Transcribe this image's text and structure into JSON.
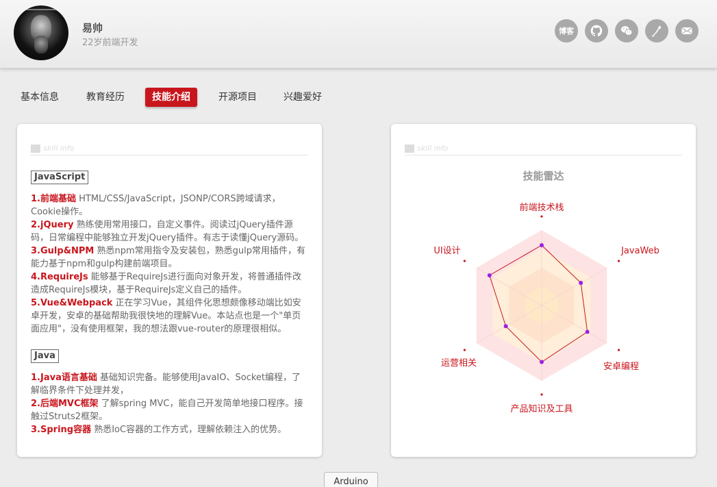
{
  "profile": {
    "name": "易帅",
    "subtitle": "22岁前端开发"
  },
  "social": [
    {
      "icon": "blog-icon",
      "label": "博客"
    },
    {
      "icon": "github-icon"
    },
    {
      "icon": "wechat-icon"
    },
    {
      "icon": "phone-icon"
    },
    {
      "icon": "mail-icon"
    }
  ],
  "tabs": [
    {
      "label": "基本信息"
    },
    {
      "label": "教育经历"
    },
    {
      "label": "技能介绍",
      "active": true
    },
    {
      "label": "开源项目"
    },
    {
      "label": "兴趣爱好"
    }
  ],
  "skill_card": {
    "header": "skill info",
    "sections": [
      {
        "title": "JavaScript",
        "items": [
          {
            "key": "1.前端基础",
            "text": " HTML/CSS/JavaScript，JSONP/CORS跨域请求，Cookie操作。"
          },
          {
            "key": "2.jQuery",
            "text": " 熟练使用常用接口，自定义事件。阅读过jQuery插件源码，日常编程中能够独立开发jQuery插件。有志于读懂jQuery源码。"
          },
          {
            "key": "3.Gulp&NPM",
            "text": " 熟悉npm常用指令及安装包，熟悉gulp常用插件，有能力基于npm和gulp构建前端项目。"
          },
          {
            "key": "4.RequireJs",
            "text": " 能够基于RequireJs进行面向对象开发，将普通插件改造成RequireJs模块，基于RequireJs定义自己的插件。"
          },
          {
            "key": "5.Vue&Webpack",
            "text": " 正在学习Vue，其组件化思想颇像移动端比如安卓开发，安卓的基础帮助我很快地的理解Vue。本站点也是一个\"单页面应用\"，没有使用框架，我的想法跟vue-router的原理很相似。"
          }
        ]
      },
      {
        "title": "Java",
        "items": [
          {
            "key": "1.Java语言基础",
            "text": " 基础知识完备。能够使用JavaIO、Socket编程，了解临界条件下处理并发，"
          },
          {
            "key": "2.后端MVC框架",
            "text": " 了解spring MVC，能自己开发简单地接口程序。接触过Struts2框架。"
          },
          {
            "key": "3.Spring容器",
            "text": " 熟悉IoC容器的工作方式，理解依赖注入的优势。"
          }
        ]
      }
    ]
  },
  "radar_card": {
    "header": "skill info",
    "title": "技能雷达",
    "indicators": [
      "前端技术栈",
      "JavaWeb",
      "安卓编程",
      "产品知识及工具",
      "运营相关",
      "UI设计"
    ],
    "values": [
      0.8,
      0.6,
      0.7,
      0.75,
      0.55,
      0.8
    ],
    "colors": {
      "line": "#c8161d",
      "point": "#9b1ee8",
      "band_outer": "#fde3e4",
      "band_mid": "#ffeed9",
      "band_inner": "#ffe2cc"
    }
  },
  "float_button": {
    "label": "Arduino"
  }
}
